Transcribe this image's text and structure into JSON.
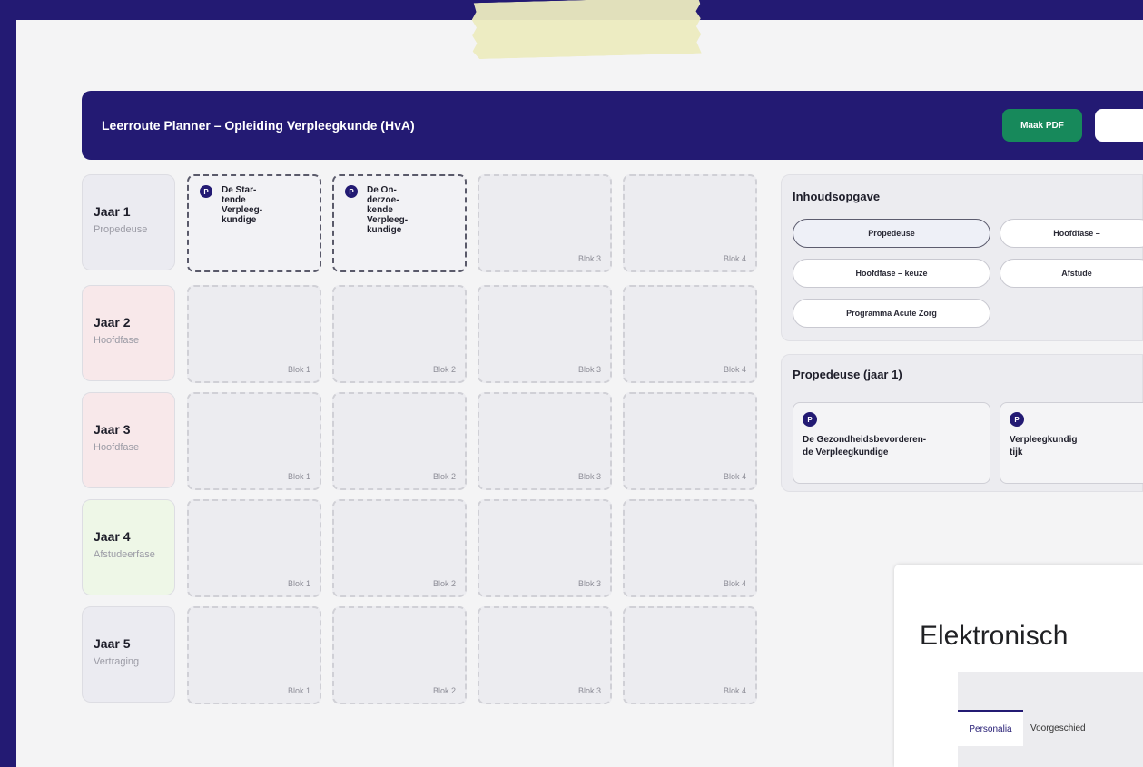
{
  "header": {
    "title": "Leerroute Planner – Opleiding Verpleegkunde (HvA)",
    "pdf_button": "Maak PDF"
  },
  "years": [
    {
      "label": "Jaar 1",
      "phase": "Propedeuse"
    },
    {
      "label": "Jaar 2",
      "phase": "Hoofdfase"
    },
    {
      "label": "Jaar 3",
      "phase": "Hoofdfase"
    },
    {
      "label": "Jaar 4",
      "phase": "Afstudeerfase"
    },
    {
      "label": "Jaar 5",
      "phase": "Vertraging"
    }
  ],
  "blocks": [
    "Blok 1",
    "Blok 2",
    "Blok 3",
    "Blok 4"
  ],
  "placed_courses": [
    {
      "badge": "P",
      "name_lines": [
        "De Star-",
        "tende",
        "Verpleeg-",
        "kundige"
      ]
    },
    {
      "badge": "P",
      "name_lines": [
        "De On-",
        "derzoe-",
        "kende",
        "Verpleeg-",
        "kundige"
      ]
    }
  ],
  "toc": {
    "title": "Inhoudsopgave",
    "items": [
      "Propedeuse",
      "Hoofdfase –",
      "Hoofdfase – keuze",
      "Afstude",
      "Programma Acute Zorg"
    ]
  },
  "section": {
    "title": "Propedeuse (jaar 1)",
    "cards": [
      {
        "badge": "P",
        "name_lines": [
          "De Gezondheidsbevorderen-",
          "de Verpleegkundige"
        ]
      },
      {
        "badge": "P",
        "name_lines": [
          "Verpleegkundig",
          "tijk"
        ]
      }
    ]
  },
  "overlay": {
    "title": "Elektronisch",
    "tabs": [
      "Personalia",
      "Voorgeschied"
    ]
  },
  "colors": {
    "brand": "#231a73",
    "pdf_button": "#17895b",
    "tape": "#ecebbf"
  }
}
